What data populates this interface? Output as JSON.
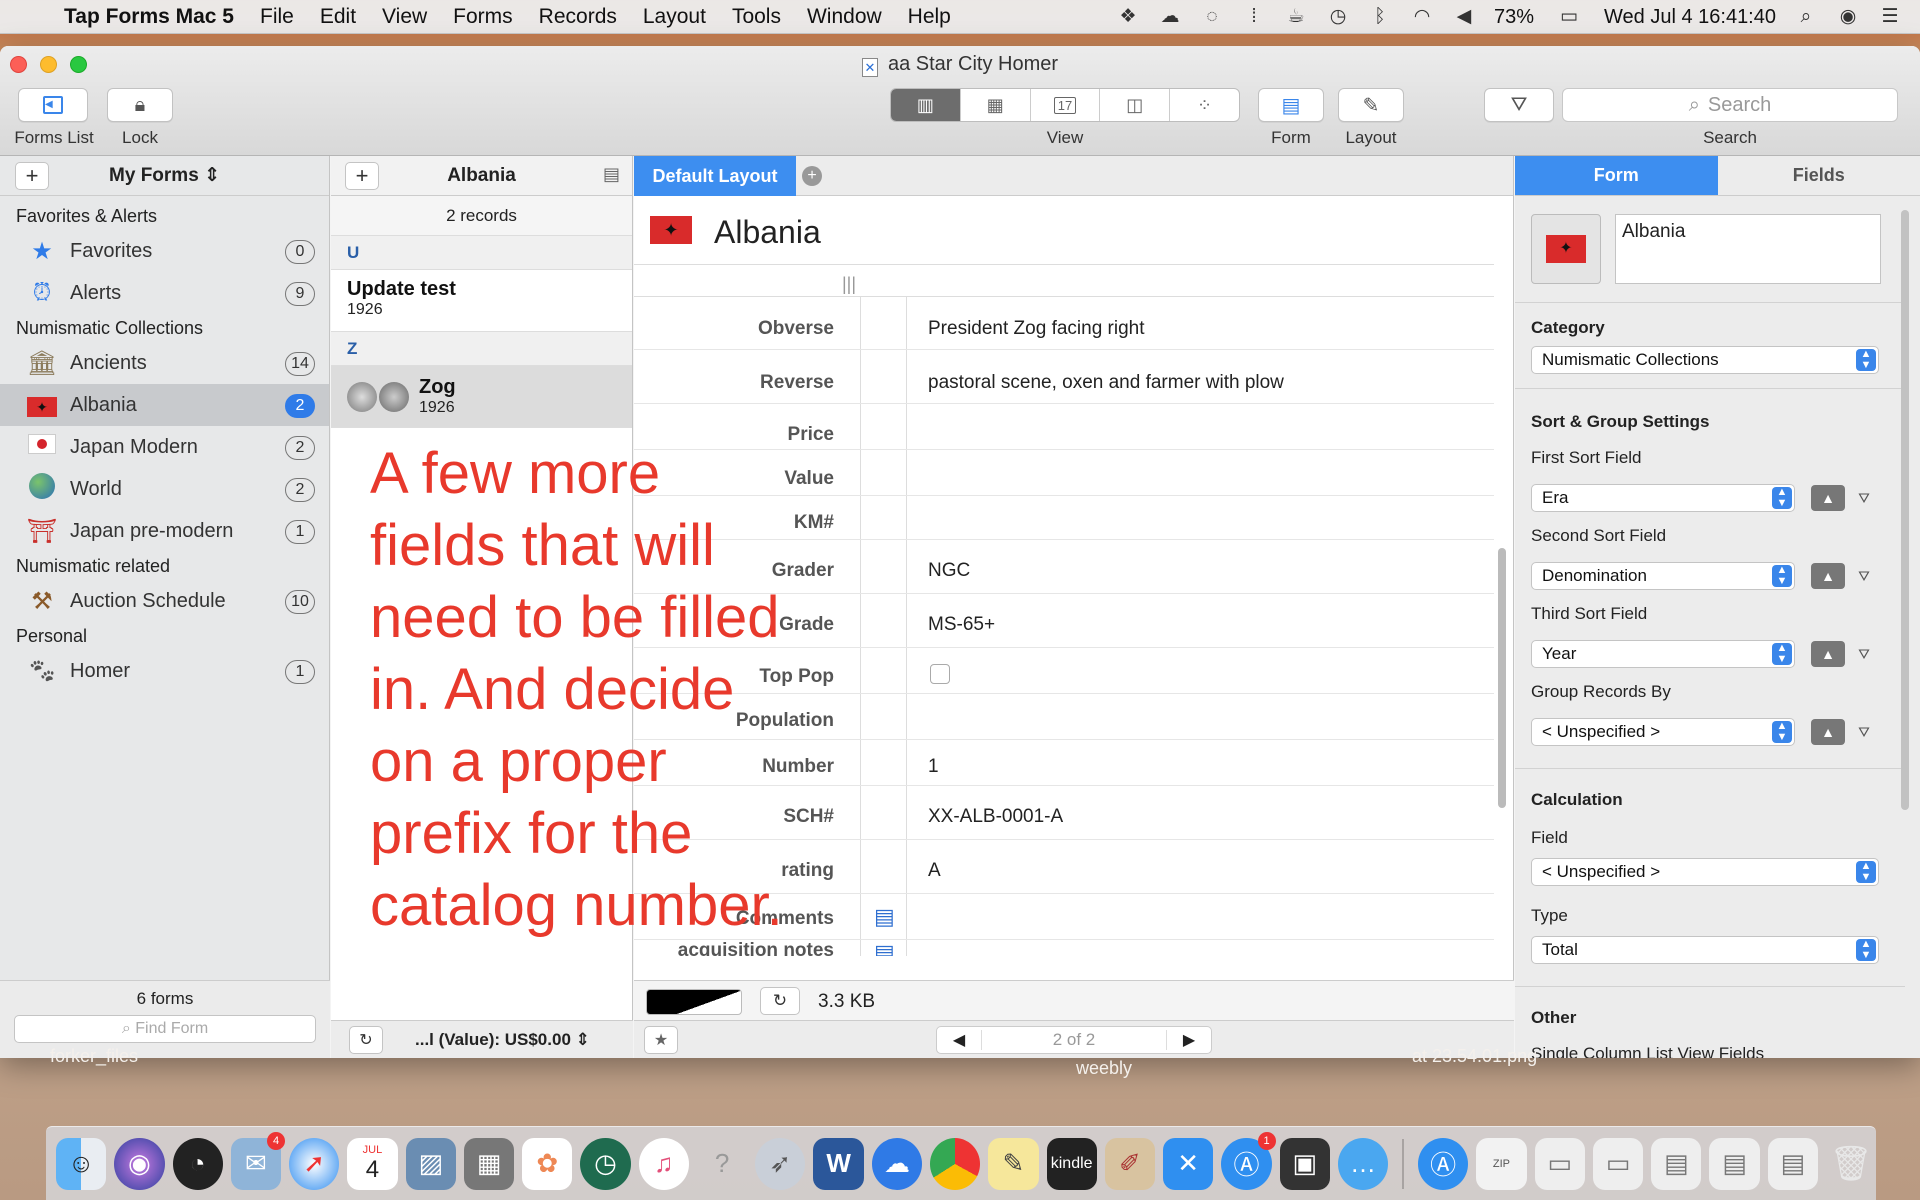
{
  "menubar": {
    "app": "Tap Forms Mac 5",
    "items": [
      "File",
      "Edit",
      "View",
      "Forms",
      "Records",
      "Layout",
      "Tools",
      "Window",
      "Help"
    ],
    "battery": "73%",
    "datetime": "Wed Jul 4  16:41:40"
  },
  "window": {
    "title": "aa Star City Homer",
    "toolbar": {
      "forms_list": "Forms List",
      "lock": "Lock",
      "view": "View",
      "form": "Form",
      "layout": "Layout",
      "search_label": "Search",
      "search_placeholder": "Search",
      "calendar_day": "17"
    }
  },
  "sidebar": {
    "header": "My Forms",
    "sections": [
      {
        "title": "Favorites & Alerts"
      },
      {
        "title": "Numismatic Collections"
      },
      {
        "title": "Numismatic related"
      },
      {
        "title": "Personal"
      }
    ],
    "items": [
      {
        "label": "Favorites",
        "count": "0",
        "icon": "star-icon"
      },
      {
        "label": "Alerts",
        "count": "9",
        "icon": "alarm-clock-icon"
      },
      {
        "label": "Ancients",
        "count": "14",
        "icon": "temple-icon"
      },
      {
        "label": "Albania",
        "count": "2",
        "icon": "albania-flag-icon"
      },
      {
        "label": "Japan Modern",
        "count": "2",
        "icon": "japan-flag-icon"
      },
      {
        "label": "World",
        "count": "2",
        "icon": "globe-icon"
      },
      {
        "label": "Japan pre-modern",
        "count": "1",
        "icon": "torii-icon"
      },
      {
        "label": "Auction Schedule",
        "count": "10",
        "icon": "gavel-icon"
      },
      {
        "label": "Homer",
        "count": "1",
        "icon": "paw-icon"
      }
    ],
    "footer_count": "6 forms",
    "find_placeholder": "Find Form"
  },
  "records": {
    "header": "Albania",
    "count": "2 records",
    "groups": [
      {
        "letter": "U",
        "title": "Update test",
        "subtitle": "1926"
      },
      {
        "letter": "Z",
        "title": "Zog",
        "subtitle": "1926"
      }
    ],
    "footer_total": "...l (Value): US$0.00"
  },
  "form": {
    "layout_tab": "Default Layout",
    "title": "Albania",
    "fields": [
      {
        "label": "Obverse",
        "value": "President Zog facing right"
      },
      {
        "label": "Reverse",
        "value": "pastoral scene, oxen and farmer with plow"
      },
      {
        "label": "Price",
        "value": ""
      },
      {
        "label": "Value",
        "value": ""
      },
      {
        "label": "KM#",
        "value": ""
      },
      {
        "label": "Grader",
        "value": "NGC"
      },
      {
        "label": "Grade",
        "value": "MS-65+"
      },
      {
        "label": "Top Pop",
        "value": ""
      },
      {
        "label": "Population",
        "value": ""
      },
      {
        "label": "Number",
        "value": "1"
      },
      {
        "label": "SCH#",
        "value": "XX-ALB-0001-A"
      },
      {
        "label": "rating",
        "value": "A"
      },
      {
        "label": "Comments",
        "value": ""
      },
      {
        "label": "acquisition notes",
        "value": ""
      }
    ],
    "file_size": "3.3 KB",
    "pager": "2 of 2"
  },
  "annotation": "A few more fields that will need to be filled in.  And decide on a proper prefix for the catalog number.",
  "inspector": {
    "tabs": [
      "Form",
      "Fields"
    ],
    "form_name": "Albania",
    "category_label": "Category",
    "category": "Numismatic Collections",
    "sort_heading": "Sort & Group Settings",
    "first_sort_label": "First Sort Field",
    "first_sort": "Era",
    "second_sort_label": "Second Sort Field",
    "second_sort": "Denomination",
    "third_sort_label": "Third Sort Field",
    "third_sort": "Year",
    "group_label": "Group Records By",
    "group": "< Unspecified >",
    "calc_heading": "Calculation",
    "calc_field_label": "Field",
    "calc_field": "< Unspecified >",
    "calc_type_label": "Type",
    "calc_type": "Total",
    "other_heading": "Other",
    "other_sub": "Single Column List View Fields"
  },
  "desktop": {
    "labels": [
      "forker_files",
      "weebly",
      "at 23.54.01.png"
    ]
  },
  "dock": {
    "calendar_month": "JUL",
    "calendar_day": "4",
    "mail_badge": "4",
    "appstore_badge": "1",
    "word_letter": "W",
    "kindle_label": "kindle",
    "zip_label": "ZIP"
  },
  "colors": {
    "accent": "#3d8ef0",
    "annotation": "#e8392c",
    "selection": "#c8cacd"
  }
}
